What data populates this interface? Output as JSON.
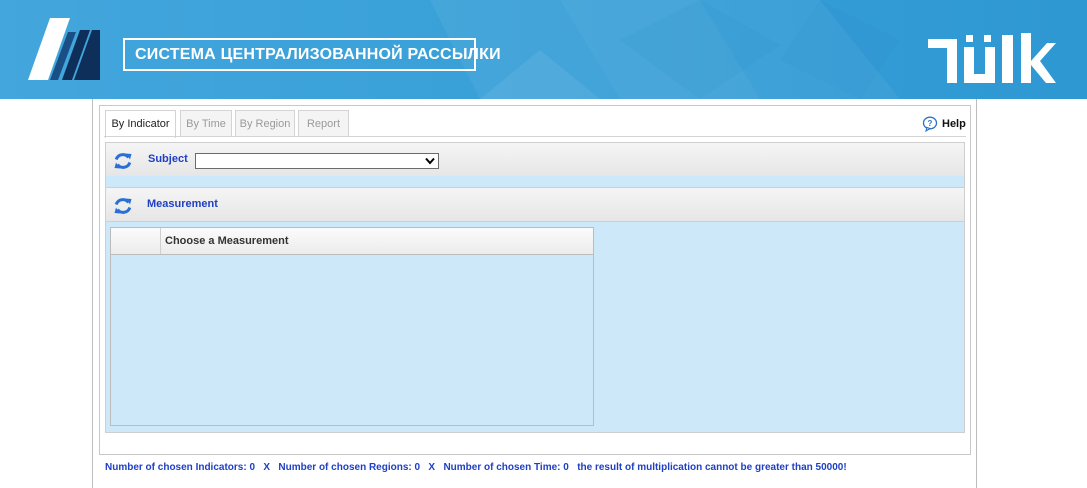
{
  "header": {
    "system_title": "СИСТЕМА ЦЕНТРАЛИЗОВАННОЙ РАССЫЛКИ",
    "brand_color": "#3aa1d9"
  },
  "tabs": [
    {
      "label": "By Indicator",
      "active": true
    },
    {
      "label": "By Time",
      "active": false
    },
    {
      "label": "By Region",
      "active": false
    },
    {
      "label": "Report",
      "active": false
    }
  ],
  "help": {
    "label": "Help",
    "icon": "help-bubble-icon"
  },
  "subject": {
    "label": "Subject",
    "selected_value": "",
    "icon": "refresh-icon"
  },
  "measurement": {
    "label": "Measurement",
    "icon": "refresh-icon",
    "table": {
      "header": "Choose a Measurement"
    }
  },
  "footer": {
    "indicators_text": "Number of chosen Indicators: 0",
    "x1": "X",
    "regions_text": "Number of chosen Regions: 0",
    "x2": "X",
    "time_text": "Number of chosen Time: 0",
    "limit_text": "the result of multiplication cannot be greater than 50000!"
  },
  "colors": {
    "accent_text": "#1f3fc4",
    "panel_fill": "#cde9f9"
  }
}
